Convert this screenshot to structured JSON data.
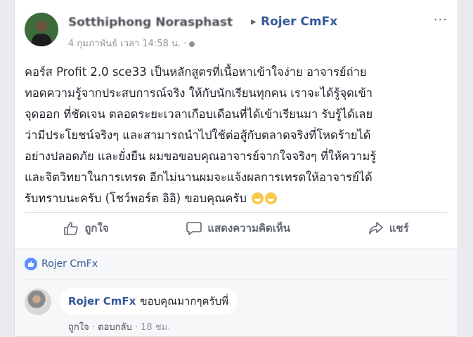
{
  "post": {
    "author": "Sotthiphong Norasphast",
    "page": "Rojer CmFx",
    "meta": "4 กุมภาพันธ์ เวลา 14:58 น. ·",
    "more": "···",
    "lines": [
      "คอร์ส Profit 2.0 sce33 เป็นหลักสูตรที่เนื้อหาเข้าใจง่าย อาจารย์ถ่าย",
      "ทอดความรู้จากประสบการณ์จริง ให้กับนักเรียนทุกคน เราจะได้รู้จุดเข้า",
      "จุดออก ที่ชัดเจน ตลอดระยะเวลาเกือบเดือนที่ได้เข้าเรียนมา รับรู้ได้เลย",
      "ว่ามีประโยชน์จริงๆ และสามารถนำไปใช้ต่อสู้กับตลาดจริงที่โหดร้ายได้",
      "อย่างปลอดภัย และยั่งยืน ผมขอขอบคุณอาจารย์จากใจจริงๆ ที่ให้ความรู้",
      "และจิตวิทยาในการเทรด อีกไม่นานผมจะแจ้งผลการเทรดให้อาจารย์ได้",
      "รับทราบนะครับ (โชว์พอร์ต อิอิ) ขอบคุณครับ"
    ],
    "emoji": "grinning-face-emoji"
  },
  "actions": {
    "like": "ถูกใจ",
    "comment": "แสดงความคิดเห็น",
    "share": "แชร์"
  },
  "likes": {
    "name": "Rojer CmFx"
  },
  "comment": {
    "name": "Rojer CmFx",
    "text": "ขอบคุณมากๆครับพี่",
    "like": "ถูกใจ",
    "reply": "ตอบกลับ",
    "sep": "·",
    "time": "18 ชม."
  },
  "colors": {
    "link": "#365899",
    "like_badge": "#5890ff",
    "emoji": "#f7c948"
  }
}
